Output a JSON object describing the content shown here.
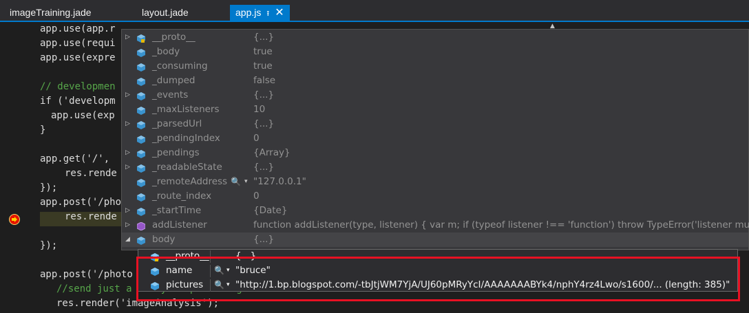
{
  "tabs": [
    {
      "label": "imageTraining.jade",
      "active": false
    },
    {
      "label": "layout.jade",
      "active": false
    },
    {
      "label": "app.js",
      "active": true
    }
  ],
  "code": {
    "lines": [
      "app.use(app.r",
      "app.use(requi",
      "app.use(expre",
      "",
      "// developmen",
      "if ('developm",
      "  app.use(exp",
      "}",
      "",
      "app.get('/',",
      "    res.rende",
      "});",
      "app.post('/pho",
      "    res.rende",
      "",
      "});",
      "",
      "app.post('/photo",
      "    //send just a dummy template right now",
      "    res.render('imageAnalysis');"
    ]
  },
  "datatip": {
    "rows": [
      {
        "name": "__proto__",
        "value": "{...}",
        "expandable": true,
        "icon": "object-locked-icon"
      },
      {
        "name": "_body",
        "value": "true",
        "expandable": false,
        "icon": "field-icon"
      },
      {
        "name": "_consuming",
        "value": "true",
        "expandable": false,
        "icon": "field-icon"
      },
      {
        "name": "_dumped",
        "value": "false",
        "expandable": false,
        "icon": "field-icon"
      },
      {
        "name": "_events",
        "value": "{...}",
        "expandable": true,
        "icon": "field-icon"
      },
      {
        "name": "_maxListeners",
        "value": "10",
        "expandable": false,
        "icon": "field-icon"
      },
      {
        "name": "_parsedUrl",
        "value": "{...}",
        "expandable": true,
        "icon": "field-icon"
      },
      {
        "name": "_pendingIndex",
        "value": "0",
        "expandable": false,
        "icon": "field-icon"
      },
      {
        "name": "_pendings",
        "value": "{Array}",
        "expandable": true,
        "icon": "field-icon"
      },
      {
        "name": "_readableState",
        "value": "{...}",
        "expandable": true,
        "icon": "field-icon"
      },
      {
        "name": "_remoteAddress",
        "value": "\"127.0.0.1\"",
        "expandable": false,
        "icon": "field-icon",
        "visualizer": true
      },
      {
        "name": "_route_index",
        "value": "0",
        "expandable": false,
        "icon": "field-icon"
      },
      {
        "name": "_startTime",
        "value": "{Date}",
        "expandable": true,
        "icon": "field-icon"
      },
      {
        "name": "addListener",
        "value": "function addListener(type, listener) {  var m;  if (typeof listener !== 'function')    throw TypeError('listener must",
        "expandable": true,
        "icon": "method-icon"
      },
      {
        "name": "body",
        "value": "{...}",
        "expandable": true,
        "expanded": true,
        "icon": "field-icon",
        "highlighted": true
      }
    ]
  },
  "subtip": {
    "rows": [
      {
        "name": "__proto__",
        "value": "{...}",
        "icon": "object-locked-icon"
      },
      {
        "name": "name",
        "value": "\"bruce\"",
        "icon": "field-icon"
      },
      {
        "name": "pictures",
        "value": "\"http://1.bp.blogspot.com/-tbJtjWM7YjA/UJ60pMRyYcI/AAAAAAABYk4/nphY4rz4Lwo/s1600/... (length: 385)\"",
        "icon": "field-icon"
      }
    ]
  },
  "colors": {
    "accent": "#007acc",
    "highlight_box": "#e81123",
    "breakpoint": "#e51400"
  }
}
